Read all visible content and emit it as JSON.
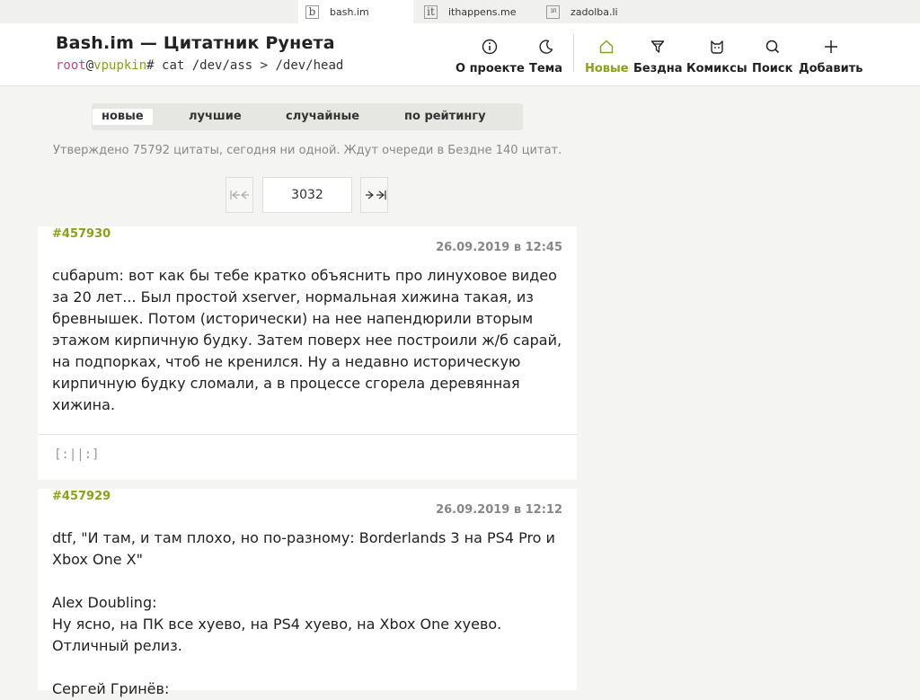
{
  "network": {
    "sites": [
      {
        "label": "bash.im",
        "logo": "b"
      },
      {
        "label": "ithappens.me",
        "logo": "it"
      },
      {
        "label": "zadolba.li",
        "logo": "ЗЛ"
      }
    ]
  },
  "header": {
    "title": "Bash.im — Цитатник Рунета",
    "prompt": {
      "user": "root",
      "at": "@",
      "host": "vpupkin",
      "command": "# cat /dev/ass > /dev/head"
    },
    "nav": [
      {
        "label": "О проекте",
        "icon": "info-icon"
      },
      {
        "label": "Тема",
        "icon": "moon-icon"
      },
      {
        "label": "Новые",
        "icon": "home-icon",
        "active": true
      },
      {
        "label": "Бездна",
        "icon": "funnel-icon"
      },
      {
        "label": "Комиксы",
        "icon": "cat-icon"
      },
      {
        "label": "Поиск",
        "icon": "search-icon"
      },
      {
        "label": "Добавить",
        "icon": "plus-icon"
      }
    ]
  },
  "sort": {
    "items": [
      "новые",
      "лучшие",
      "случайные",
      "по рейтингу"
    ],
    "active": "новые"
  },
  "stats": "Утверждено 75792 цитаты, сегодня ни одной. Ждут очереди в Бездне 140 цитат.",
  "pager": {
    "page": "3032"
  },
  "quotes": [
    {
      "id": "#457930",
      "date": "26.09.2019 в 12:45",
      "text": "cuбapum: вот как бы тебе кратко объяснить про линуховое видео за 20 лет... Был простой xserver, нормальная хижина такая, из бревнышек. Потом (исторически) на нее напендюрили вторым этажом кирпичную будку. Затем поверх нее построили ж/б сарай, на подпорках, чтоб не кренился. Ну а недавно историческую кирпичную будку сломали, а в процессе сгорела деревянная хижина.",
      "rating": "[:||:]"
    },
    {
      "id": "#457929",
      "date": "26.09.2019 в 12:12",
      "text": "dtf, \"И там, и там плохо, но по-разному: Borderlands 3 на PS4 Pro и Xbox One X\"\n\nAlex Doubling:\nНу ясно, на ПК все хуево, на PS4 хуево, на Xbox One хуево. Отличный релиз.\n\nСергей Гринёв:"
    }
  ],
  "colors": {
    "accent": "#8aa315",
    "prompt_user": "#c04a85",
    "muted": "#888888"
  }
}
